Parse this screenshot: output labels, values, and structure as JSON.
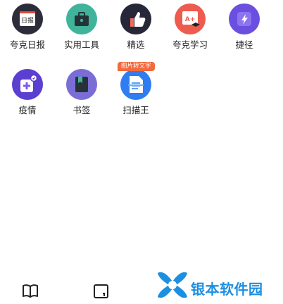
{
  "apps": [
    {
      "label": "夸克日报",
      "icon": "daily-newspaper-icon",
      "icon_text": "日报",
      "color": "#2c2c3a"
    },
    {
      "label": "实用工具",
      "icon": "toolbox-briefcase-icon",
      "color": "#3fb49a"
    },
    {
      "label": "精选",
      "icon": "thumbs-up-icon",
      "color": "#262738"
    },
    {
      "label": "夸克学习",
      "icon": "learning-board-icon",
      "icon_text": "A+",
      "color": "#ee5b4f"
    },
    {
      "label": "捷径",
      "icon": "shortcut-lightning-icon",
      "color": "#6b4fe0"
    },
    {
      "label": "疫情",
      "icon": "epidemic-medical-icon",
      "color": "#5a3fd0"
    },
    {
      "label": "书签",
      "icon": "bookmark-icon",
      "color": "#7a6ed6"
    },
    {
      "label": "扫描王",
      "icon": "scanner-document-icon",
      "color": "#2f7df0",
      "badge": "图片转文字"
    }
  ],
  "bottom_nav": {
    "items": [
      {
        "name": "book-icon"
      },
      {
        "name": "tabs-icon"
      }
    ]
  },
  "watermark": {
    "text": "银本软件园",
    "color": "#1d8fe0"
  }
}
